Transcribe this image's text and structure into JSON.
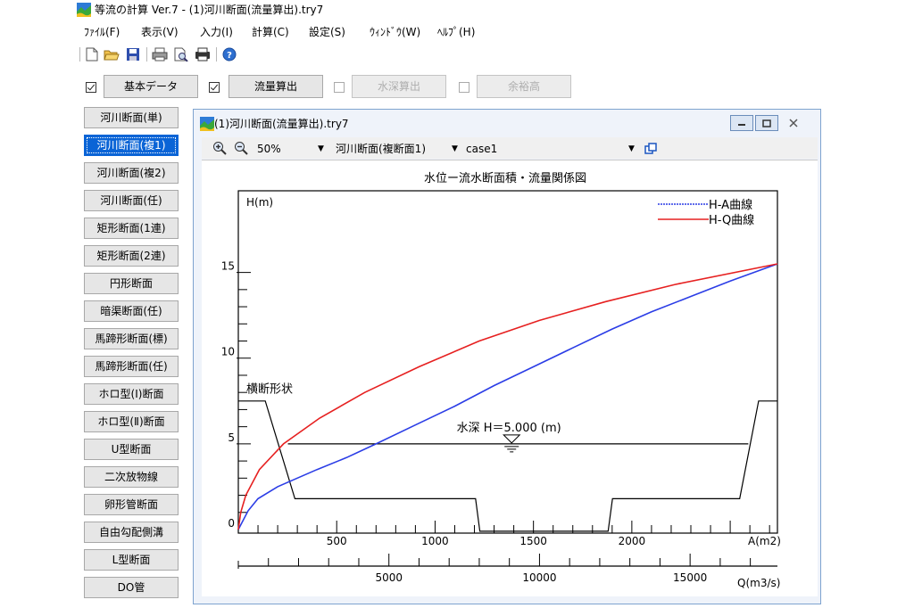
{
  "window": {
    "title": "等流の計算 Ver.7 - (1)河川断面(流量算出).try7"
  },
  "menu": [
    "ﾌｧｲﾙ(F)",
    "表示(V)",
    "入力(I)",
    "計算(C)",
    "設定(S)",
    "ｳｨﾝﾄﾞｳ(W)",
    "ﾍﾙﾌﾟ(H)"
  ],
  "toolbar": {
    "icons": [
      "new-file-icon",
      "open-folder-icon",
      "save-icon",
      "print-icon",
      "print-preview-icon",
      "printer-setup-icon",
      "help-icon"
    ]
  },
  "top_buttons": [
    {
      "label": "基本データ",
      "checked": true,
      "enabled": true
    },
    {
      "label": "流量算出",
      "checked": true,
      "enabled": true
    },
    {
      "label": "水深算出",
      "checked": false,
      "enabled": false
    },
    {
      "label": "余裕高",
      "checked": false,
      "enabled": false
    }
  ],
  "sidebar": {
    "selected": "河川断面(複1)",
    "items": [
      "河川断面(単)",
      "河川断面(複1)",
      "河川断面(複2)",
      "河川断面(任)",
      "矩形断面(1連)",
      "矩形断面(2連)",
      "円形断面",
      "暗渠断面(任)",
      "馬蹄形断面(標)",
      "馬蹄形断面(任)",
      "ホロ型(Ⅰ)断面",
      "ホロ型(Ⅱ)断面",
      "U型断面",
      "二次放物線",
      "卵形管断面",
      "自由勾配側溝",
      "L型断面",
      "DO管"
    ]
  },
  "child": {
    "title": "(1)河川断面(流量算出).try7",
    "zoom": "50%",
    "section": "河川断面(複断面1)",
    "case": "case1"
  },
  "chart_data": {
    "type": "line",
    "title": "水位ー流水断面積・流量関係図",
    "ylabel": "H(m)",
    "xlabel_area": "A(m2)",
    "xlabel_flow": "Q(m3/s)",
    "ylim": [
      0,
      15.5
    ],
    "y_ticks": [
      0,
      5,
      10,
      15
    ],
    "area_range": [
      0,
      2740
    ],
    "area_ticks": [
      500,
      1000,
      1500,
      2000
    ],
    "flow_range": [
      0,
      17900
    ],
    "flow_ticks": [
      5000,
      10000,
      15000
    ],
    "series": [
      {
        "name": "H-A曲線",
        "color": "#2b3de6",
        "axis": "area",
        "points": [
          [
            0,
            0
          ],
          [
            50,
            1.1
          ],
          [
            100,
            1.8
          ],
          [
            200,
            2.5
          ],
          [
            300,
            3.0
          ],
          [
            400,
            3.5
          ],
          [
            550,
            4.2
          ],
          [
            700,
            5.0
          ],
          [
            900,
            6.1
          ],
          [
            1100,
            7.2
          ],
          [
            1300,
            8.4
          ],
          [
            1500,
            9.5
          ],
          [
            1700,
            10.6
          ],
          [
            1900,
            11.7
          ],
          [
            2100,
            12.7
          ],
          [
            2300,
            13.6
          ],
          [
            2500,
            14.5
          ],
          [
            2740,
            15.5
          ]
        ]
      },
      {
        "name": "H-Q曲線",
        "color": "#e62020",
        "axis": "flow",
        "points": [
          [
            0,
            0
          ],
          [
            80,
            1.0
          ],
          [
            250,
            2.0
          ],
          [
            700,
            3.5
          ],
          [
            1500,
            5.0
          ],
          [
            2700,
            6.5
          ],
          [
            4200,
            8.0
          ],
          [
            6000,
            9.5
          ],
          [
            8000,
            11.0
          ],
          [
            10000,
            12.2
          ],
          [
            12200,
            13.3
          ],
          [
            14500,
            14.3
          ],
          [
            17900,
            15.5
          ]
        ]
      }
    ],
    "cross_section": {
      "label": "横断形状",
      "points": [
        [
          -0.1,
          7.5
        ],
        [
          0.05,
          7.5
        ],
        [
          0.105,
          1.8
        ],
        [
          0.44,
          1.8
        ],
        [
          0.448,
          -0.1
        ],
        [
          0.686,
          -0.1
        ],
        [
          0.694,
          1.8
        ],
        [
          0.93,
          1.8
        ],
        [
          0.965,
          7.5
        ],
        [
          1.01,
          7.5
        ]
      ]
    },
    "water_level": {
      "value": 5.0,
      "label": "水深 H＝5.000 (m)"
    }
  }
}
